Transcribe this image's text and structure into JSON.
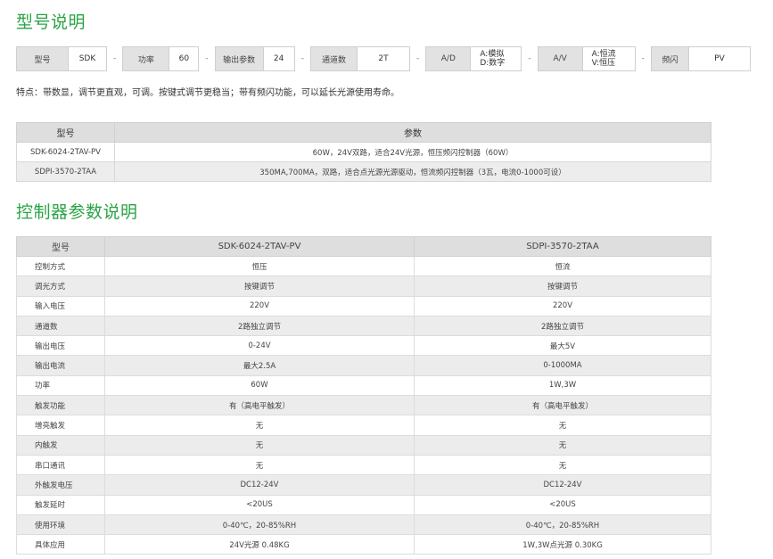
{
  "title_model": "型号说明",
  "title_params": "控制器参数说明",
  "model_strip": [
    {
      "label": "型号",
      "value": "SDK"
    },
    {
      "label": "功率",
      "value": "60"
    },
    {
      "label": "输出参数",
      "value": "24"
    },
    {
      "label": "通道数",
      "value": "2T"
    },
    {
      "label": "A/D",
      "value_lines": [
        "A:模拟",
        "D:数字"
      ]
    },
    {
      "label": "A/V",
      "value_lines": [
        "A:恒流",
        "V:恒压"
      ]
    },
    {
      "label": "频闪",
      "value": "PV"
    }
  ],
  "dash": "-",
  "features": "特点：带数显，调节更直观，可调。按键式调节更稳当；带有频闪功能，可以延长光源使用寿命。",
  "model_table": {
    "headers": [
      "型号",
      "参数"
    ],
    "rows": [
      [
        "SDK-6024-2TAV-PV",
        "60W，24V双路，适合24V光源，恒压频闪控制器（60W）"
      ],
      [
        "SDPI-3570-2TAA",
        "350MA,700MA，双路，适合点光源光源驱动，恒流频闪控制器（3瓦，电流0-1000可设）"
      ]
    ]
  },
  "param_table": {
    "headers": [
      "型号",
      "SDK-6024-2TAV-PV",
      "SDPI-3570-2TAA"
    ],
    "rows": [
      [
        "控制方式",
        "恒压",
        "恒流"
      ],
      [
        "调光方式",
        "按键调节",
        "按键调节"
      ],
      [
        "输入电压",
        "220V",
        "220V"
      ],
      [
        "通道数",
        "2路独立调节",
        "2路独立调节"
      ],
      [
        "输出电压",
        "0-24V",
        "最大5V"
      ],
      [
        "输出电流",
        "最大2.5A",
        "0-1000MA"
      ],
      [
        "功率",
        "60W",
        "1W,3W"
      ],
      [
        "触发功能",
        "有（高电平触发）",
        "有（高电平触发）"
      ],
      [
        "增亮触发",
        "无",
        "无"
      ],
      [
        "内触发",
        "无",
        "无"
      ],
      [
        "串口通讯",
        "无",
        "无"
      ],
      [
        "外触发电压",
        "DC12-24V",
        "DC12-24V"
      ],
      [
        "触发延时",
        "<20US",
        "<20US"
      ],
      [
        "使用环境",
        "0-40℃，20-85%RH",
        "0-40℃，20-85%RH"
      ],
      [
        "具体应用",
        "24V光源 0.48KG",
        "1W,3W点光源 0.30KG"
      ]
    ]
  }
}
